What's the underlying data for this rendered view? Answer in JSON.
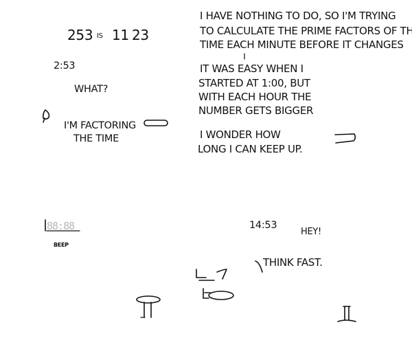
{
  "panel1": {
    "factor_number": "253",
    "factor_word": "IS",
    "factor_a": "11",
    "factor_b": "23",
    "clock": "2:53",
    "speech_what": "WHAT?",
    "speech_line1": "I'M FACTORING",
    "speech_line2": "THE TIME"
  },
  "panel2": {
    "line1": "I HAVE NOTHING TO DO, SO I'M TRYING",
    "line2": "TO CALCULATE THE PRIME FACTORS OF THE",
    "line3": "TIME EACH MINUTE BEFORE IT CHANGES",
    "line4": "IT WAS EASY WHEN I",
    "line5": "STARTED AT 1:00, BUT",
    "line6": "WITH EACH HOUR THE",
    "line7": "NUMBER GETS BIGGER",
    "line8": "I WONDER HOW",
    "line9": "LONG I CAN KEEP UP."
  },
  "panel3": {
    "display": "88:88",
    "sound": "BEEP"
  },
  "panel4": {
    "clock": "14:53",
    "speech_hey": "HEY!",
    "speech_think_fast": "THINK FAST."
  },
  "colors": {
    "ink": "#111111",
    "background": "#ffffff",
    "lcd_digits": "#b8b8b8"
  }
}
